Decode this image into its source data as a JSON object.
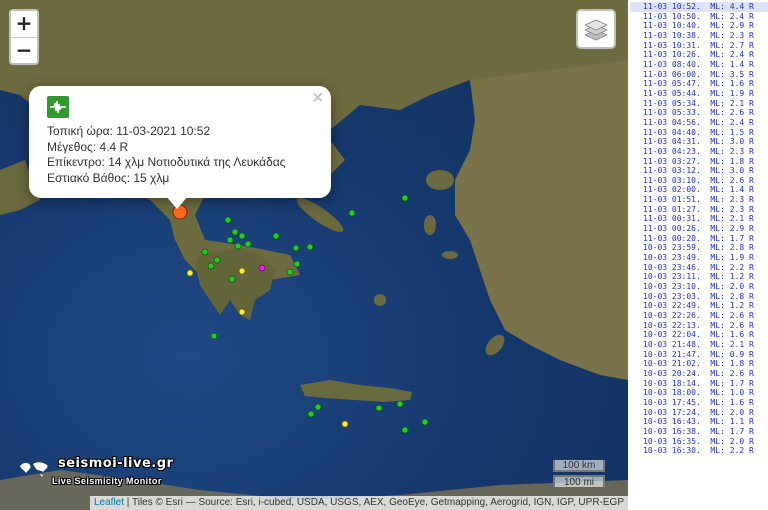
{
  "map": {
    "zoom_in_label": "+",
    "zoom_out_label": "−",
    "popup": {
      "close_label": "×",
      "local_time_label": "Τοπική ώρα:",
      "local_time": "11-03-2021 10:52",
      "magnitude_label": "Μέγεθος:",
      "magnitude": "4.4 R",
      "epicenter_label": "Επίκεντρο:",
      "epicenter": "14 χλμ Νοτιοδυτικά της Λευκάδας",
      "depth_label": "Εστιακό Βάθος:",
      "depth": "15 χλμ"
    },
    "logo_title": "seismoi-live.gr",
    "logo_subtitle": "Live Seismicity Monitor",
    "scale_km": "100 km",
    "scale_mi": "100 mi",
    "attribution_leaflet": "Leaflet",
    "attribution_rest": " | Tiles © Esri — Source: Esri, i-cubed, USDA, USGS, AEX, GeoEye, Getmapping, Aerogrid, IGN, IGP, UPR-EGP",
    "colors": {
      "sea": "#163a6e",
      "land": "#6b6a3e",
      "marker_main": "#ff6a1a",
      "marker_green": "#22cc22",
      "marker_yellow": "#ffee22",
      "marker_magenta": "#ee22ee"
    }
  },
  "list": {
    "items": [
      {
        "text": "11-03 10:52.  ML: 4.4 R",
        "selected": true
      },
      {
        "text": "11-03 10:50.  ML: 2.4 R"
      },
      {
        "text": "11-03 10:40.  ML: 2.9 R"
      },
      {
        "text": "11-03 10:38.  ML: 2.3 R"
      },
      {
        "text": "11-03 10:31.  ML: 2.7 R"
      },
      {
        "text": "11-03 10:26.  ML: 2.4 R"
      },
      {
        "text": "11-03 08:40.  ML: 1.4 R"
      },
      {
        "text": "11-03 06:00.  ML: 3.5 R"
      },
      {
        "text": "11-03 05:47.  ML: 1.6 R"
      },
      {
        "text": "11-03 05:44.  ML: 1.9 R"
      },
      {
        "text": "11-03 05:34.  ML: 2.1 R"
      },
      {
        "text": "11-03 05:33.  ML: 2.6 R"
      },
      {
        "text": "11-03 04:56.  ML: 2.4 R"
      },
      {
        "text": "11-03 04:40.  ML: 1.5 R"
      },
      {
        "text": "11-03 04:31.  ML: 3.0 R"
      },
      {
        "text": "11-03 04:23.  ML: 2.3 R"
      },
      {
        "text": "11-03 03:27.  ML: 1.8 R"
      },
      {
        "text": "11-03 03:12.  ML: 3.0 R"
      },
      {
        "text": "11-03 03:10.  ML: 2.6 R"
      },
      {
        "text": "11-03 02:00.  ML: 1.4 R"
      },
      {
        "text": "11-03 01:51.  ML: 2.3 R"
      },
      {
        "text": "11-03 01:27.  ML: 2.3 R"
      },
      {
        "text": "11-03 00:31.  ML: 2.1 R"
      },
      {
        "text": "11-03 00:26.  ML: 2.9 R"
      },
      {
        "text": "11-03 00:20.  ML: 1.7 R"
      },
      {
        "text": "10-03 23:59.  ML: 2.8 R"
      },
      {
        "text": "10-03 23:49.  ML: 1.9 R"
      },
      {
        "text": "10-03 23:46.  ML: 2.2 R"
      },
      {
        "text": "10-03 23:11.  ML: 1.2 R"
      },
      {
        "text": "10-03 23:10.  ML: 2.0 R"
      },
      {
        "text": "10-03 23:03.  ML: 2.8 R"
      },
      {
        "text": "10-03 22:49.  ML: 1.2 R"
      },
      {
        "text": "10-03 22:26.  ML: 2.6 R"
      },
      {
        "text": "10-03 22:13.  ML: 2.6 R"
      },
      {
        "text": "10-03 22:04.  ML: 1.6 R"
      },
      {
        "text": "10-03 21:48.  ML: 2.1 R"
      },
      {
        "text": "10-03 21:47.  ML: 0.9 R"
      },
      {
        "text": "10-03 21:02.  ML: 1.8 R"
      },
      {
        "text": "10-03 20:24.  ML: 2.6 R"
      },
      {
        "text": "10-03 18:14.  ML: 1.7 R"
      },
      {
        "text": "10-03 18:00.  ML: 1.0 R"
      },
      {
        "text": "10-03 17:45.  ML: 1.6 R"
      },
      {
        "text": "10-03 17:24.  ML: 2.0 R"
      },
      {
        "text": "10-03 16:43.  ML: 1.1 R"
      },
      {
        "text": "10-03 16:38.  ML: 1.7 R"
      },
      {
        "text": "10-03 16:35.  ML: 2.0 R"
      },
      {
        "text": "10-03 16:30.  ML: 2.2 R"
      }
    ]
  }
}
